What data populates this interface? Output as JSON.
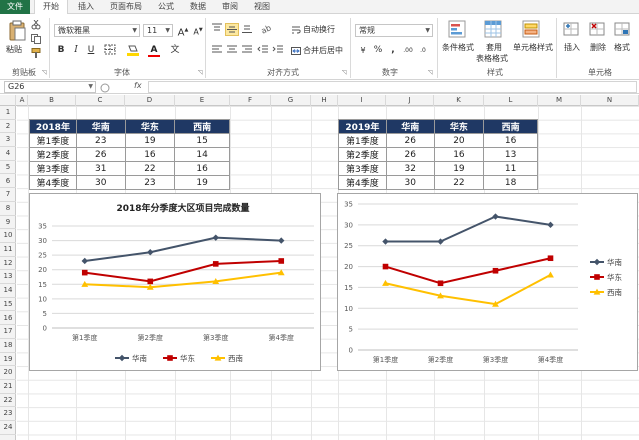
{
  "ribbon": {
    "tabs": [
      "文件",
      "开始",
      "插入",
      "页面布局",
      "公式",
      "数据",
      "审阅",
      "视图"
    ],
    "clipboard": {
      "paste": "粘贴",
      "group": "剪贴板"
    },
    "font": {
      "name": "微软雅黑",
      "size": "11",
      "group": "字体"
    },
    "align": {
      "wrap": "自动换行",
      "merge": "合并后居中",
      "group": "对齐方式"
    },
    "number": {
      "format": "常规",
      "group": "数字"
    },
    "styles": {
      "conditional": "条件格式",
      "table_1": "套用",
      "table_2": "表格格式",
      "cell": "单元格样式",
      "group": "样式"
    },
    "cells": {
      "insert": "插入",
      "delete": "删除",
      "format": "格式",
      "group": "单元格"
    }
  },
  "formula_bar": {
    "name_box": "G26",
    "fx": "fx"
  },
  "columns": [
    "A",
    "B",
    "C",
    "D",
    "E",
    "F",
    "G",
    "H",
    "I",
    "J",
    "K",
    "L",
    "M",
    "N"
  ],
  "rows": [
    "1",
    "2",
    "3",
    "4",
    "5",
    "6",
    "7",
    "8",
    "9",
    "10",
    "11",
    "12",
    "13",
    "14",
    "15",
    "16",
    "17",
    "18",
    "19",
    "20",
    "21",
    "22",
    "23",
    "24"
  ],
  "table_2018": {
    "headers": [
      "2018年",
      "华南",
      "华东",
      "西南"
    ],
    "rows": [
      [
        "第1季度",
        "23",
        "19",
        "15"
      ],
      [
        "第2季度",
        "26",
        "16",
        "14"
      ],
      [
        "第3季度",
        "31",
        "22",
        "16"
      ],
      [
        "第4季度",
        "30",
        "23",
        "19"
      ]
    ]
  },
  "table_2019": {
    "headers": [
      "2019年",
      "华南",
      "华东",
      "西南"
    ],
    "rows": [
      [
        "第1季度",
        "26",
        "20",
        "16"
      ],
      [
        "第2季度",
        "26",
        "16",
        "13"
      ],
      [
        "第3季度",
        "32",
        "19",
        "11"
      ],
      [
        "第4季度",
        "30",
        "22",
        "18"
      ]
    ]
  },
  "chart_data": [
    {
      "type": "line",
      "title": "2018年分季度大区项目完成数量",
      "categories": [
        "第1季度",
        "第2季度",
        "第3季度",
        "第4季度"
      ],
      "series": [
        {
          "name": "华南",
          "values": [
            23,
            26,
            31,
            30
          ],
          "color": "#44546a",
          "marker": "diamond"
        },
        {
          "name": "华东",
          "values": [
            19,
            16,
            22,
            23
          ],
          "color": "#c00000",
          "marker": "square"
        },
        {
          "name": "西南",
          "values": [
            15,
            14,
            16,
            19
          ],
          "color": "#ffc000",
          "marker": "triangle"
        }
      ],
      "ylim": [
        0,
        35
      ],
      "yticks": [
        0,
        5,
        10,
        15,
        20,
        25,
        30,
        35
      ],
      "grid": true,
      "legend": "bottom"
    },
    {
      "type": "line",
      "title": "",
      "categories": [
        "第1季度",
        "第2季度",
        "第3季度",
        "第4季度"
      ],
      "series": [
        {
          "name": "华南",
          "values": [
            26,
            26,
            32,
            30
          ],
          "color": "#44546a",
          "marker": "diamond"
        },
        {
          "name": "华东",
          "values": [
            20,
            16,
            19,
            22
          ],
          "color": "#c00000",
          "marker": "square"
        },
        {
          "name": "西南",
          "values": [
            16,
            13,
            11,
            18
          ],
          "color": "#ffc000",
          "marker": "triangle"
        }
      ],
      "ylim": [
        0,
        35
      ],
      "yticks": [
        0,
        5,
        10,
        15,
        20,
        25,
        30,
        35
      ],
      "grid": true,
      "legend": "right"
    }
  ]
}
